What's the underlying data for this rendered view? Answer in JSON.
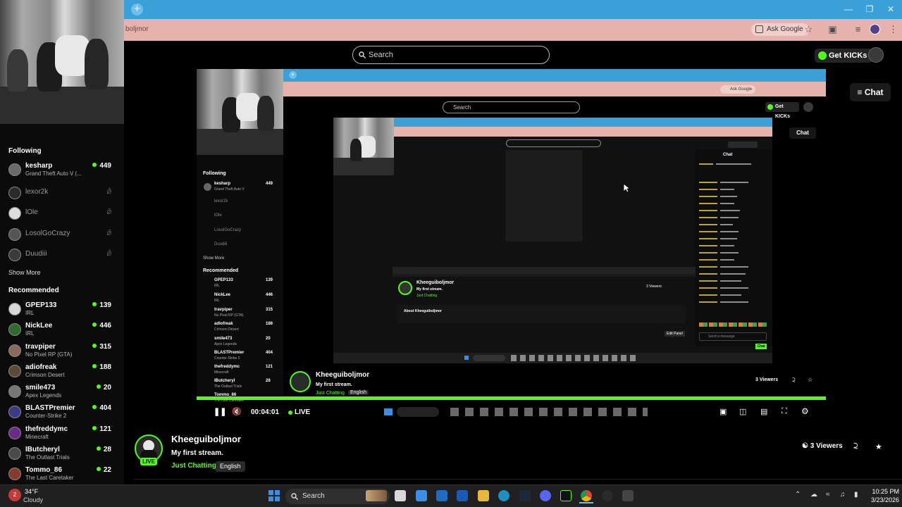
{
  "browser": {
    "address_text": "boljmor",
    "ask_google": "Ask Google"
  },
  "header": {
    "search_placeholder": "Search",
    "get_kicks": "Get KICKs",
    "chat": "Chat"
  },
  "sidebar": {
    "following_heading": "Following",
    "following": [
      {
        "name": "kesharp",
        "game": "Grand Theft Auto V (...",
        "viewers": "449",
        "live": true
      },
      {
        "name": "lexor2k",
        "live": false
      },
      {
        "name": "lOle",
        "live": false
      },
      {
        "name": "LosolGoCrazy",
        "live": false
      },
      {
        "name": "Duudiii",
        "live": false
      }
    ],
    "show_more": "Show More",
    "recommended_heading": "Recommended",
    "recommended": [
      {
        "name": "GPEP133",
        "game": "IRL",
        "viewers": "139"
      },
      {
        "name": "NickLee",
        "game": "IRL",
        "viewers": "446"
      },
      {
        "name": "travpiper",
        "game": "No Pixel RP (GTA)",
        "viewers": "315"
      },
      {
        "name": "adiofreak",
        "game": "Crimson Desert",
        "viewers": "188"
      },
      {
        "name": "smile473",
        "game": "Apex Legends",
        "viewers": "20"
      },
      {
        "name": "BLASTPremier",
        "game": "Counter-Strike 2",
        "viewers": "404"
      },
      {
        "name": "thefreddymc",
        "game": "Minecraft",
        "viewers": "121"
      },
      {
        "name": "IButcheryl",
        "game": "The Outlast Trials",
        "viewers": "28"
      },
      {
        "name": "Tommo_86",
        "game": "The Last Caretaker",
        "viewers": "22"
      }
    ]
  },
  "nested_stream": {
    "name": "Kheeguiboljmor",
    "title": "My first stream.",
    "category": "Just Chatting",
    "language": "English",
    "viewers": "3 Viewers",
    "time": "00:04:01",
    "live": "LIVE",
    "search_placeholder": "Search",
    "get_kicks": "Get KICKs",
    "chat": "Chat",
    "ask_google": "Ask Google",
    "following_heading": "Following",
    "show_more": "Show More",
    "recommended_heading": "Recommended",
    "following": [
      {
        "name": "kesharp",
        "game": "Grand Theft Auto V",
        "viewers": "449"
      },
      {
        "name": "lexor2k"
      },
      {
        "name": "lOle"
      },
      {
        "name": "LosolGoCrazy"
      },
      {
        "name": "Duudiii"
      }
    ],
    "recommended": [
      {
        "name": "GPEP133",
        "game": "IRL",
        "viewers": "139"
      },
      {
        "name": "NickLee",
        "game": "IRL",
        "viewers": "446"
      },
      {
        "name": "travpiper",
        "game": "No Pixel RP (GTA)",
        "viewers": "315"
      },
      {
        "name": "adiofreak",
        "game": "Crimson Desert",
        "viewers": "188"
      },
      {
        "name": "smile473",
        "game": "Apex Legends",
        "viewers": "20"
      },
      {
        "name": "BLASTPremier",
        "game": "Counter-Strike 2",
        "viewers": "404"
      },
      {
        "name": "thefreddymc",
        "game": "Minecraft",
        "viewers": "121"
      },
      {
        "name": "IButcheryl",
        "game": "The Outlast Trials",
        "viewers": "28"
      },
      {
        "name": "Tommo_86",
        "game": "The Last Caretaker",
        "viewers": ""
      }
    ],
    "deep_name": "Kheeguiboljmor",
    "deep_title": "My first stream.",
    "deep_about": "About Kheeguiboljmor",
    "deep_viewers": "3 Viewers",
    "deep_edit": "Edit Panel",
    "deep_send": "Send a message",
    "deep_chat_btn": "Chat",
    "deep_chat_heading": "Chat"
  },
  "stream": {
    "name": "Kheeguiboljmor",
    "title": "My first stream.",
    "category": "Just Chatting",
    "language": "English",
    "viewers_count": "3",
    "viewers_label": "Viewers",
    "live_badge": "LIVE"
  },
  "taskbar": {
    "temp": "34°F",
    "weather": "Cloudy",
    "search": "Search",
    "time": "10:25 PM",
    "date": "3/23/2026"
  },
  "colors": {
    "kick_green": "#53fc18",
    "tab_blue": "#3aa0d8",
    "addr_pink": "#e5b2ac"
  }
}
